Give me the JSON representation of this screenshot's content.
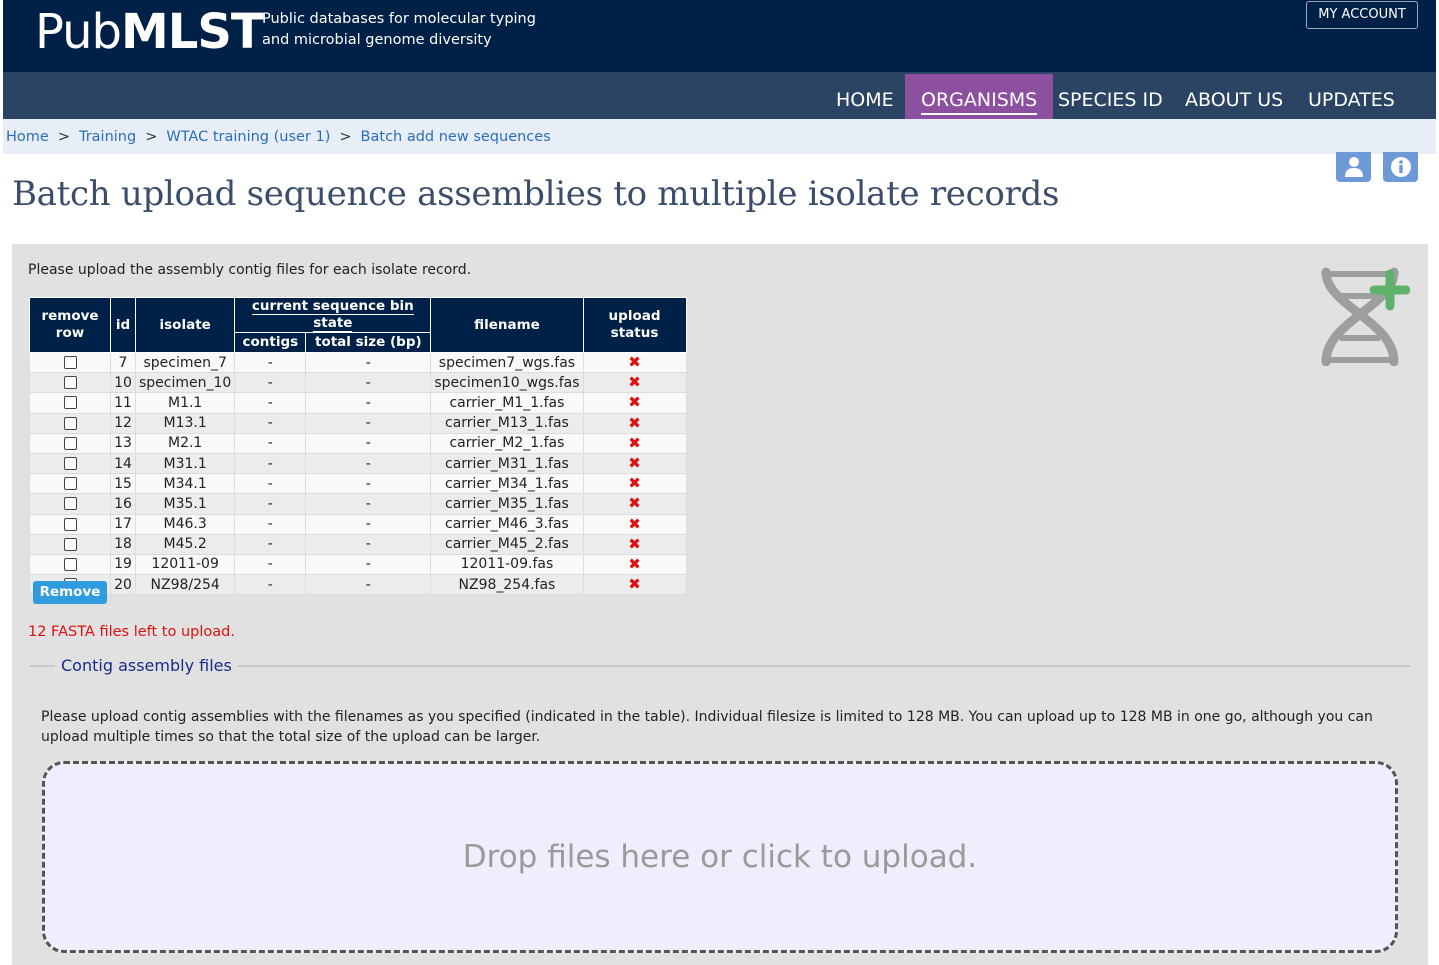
{
  "header": {
    "logo_regular": "Pub",
    "logo_bold": "MLST",
    "tagline": "Public databases for molecular typing\nand microbial genome diversity",
    "my_account": "MY ACCOUNT"
  },
  "nav": {
    "items": [
      {
        "label": "HOME"
      },
      {
        "label": "ORGANISMS"
      },
      {
        "label": "SPECIES ID"
      },
      {
        "label": "ABOUT US"
      },
      {
        "label": "UPDATES"
      }
    ],
    "active": "ORGANISMS"
  },
  "breadcrumb": {
    "items": [
      "Home",
      "Training",
      "WTAC training (user 1)",
      "Batch add new sequences"
    ],
    "separator": ">"
  },
  "page": {
    "title": "Batch upload sequence assemblies to multiple isolate records",
    "intro": "Please upload the assembly contig files for each isolate record."
  },
  "table": {
    "headers": {
      "remove_row": "remove row",
      "id": "id",
      "isolate": "isolate",
      "bin_state": "current sequence bin state",
      "contigs": "contigs",
      "total_size": "total size (bp)",
      "filename": "filename",
      "upload_status": "upload status"
    },
    "rows": [
      {
        "id": "7",
        "isolate": "specimen_7",
        "contigs": "-",
        "total_size": "-",
        "filename": "specimen7_wgs.fas",
        "status": "✖"
      },
      {
        "id": "10",
        "isolate": "specimen_10",
        "contigs": "-",
        "total_size": "-",
        "filename": "specimen10_wgs.fas",
        "status": "✖"
      },
      {
        "id": "11",
        "isolate": "M1.1",
        "contigs": "-",
        "total_size": "-",
        "filename": "carrier_M1_1.fas",
        "status": "✖"
      },
      {
        "id": "12",
        "isolate": "M13.1",
        "contigs": "-",
        "total_size": "-",
        "filename": "carrier_M13_1.fas",
        "status": "✖"
      },
      {
        "id": "13",
        "isolate": "M2.1",
        "contigs": "-",
        "total_size": "-",
        "filename": "carrier_M2_1.fas",
        "status": "✖"
      },
      {
        "id": "14",
        "isolate": "M31.1",
        "contigs": "-",
        "total_size": "-",
        "filename": "carrier_M31_1.fas",
        "status": "✖"
      },
      {
        "id": "15",
        "isolate": "M34.1",
        "contigs": "-",
        "total_size": "-",
        "filename": "carrier_M34_1.fas",
        "status": "✖"
      },
      {
        "id": "16",
        "isolate": "M35.1",
        "contigs": "-",
        "total_size": "-",
        "filename": "carrier_M35_1.fas",
        "status": "✖"
      },
      {
        "id": "17",
        "isolate": "M46.3",
        "contigs": "-",
        "total_size": "-",
        "filename": "carrier_M46_3.fas",
        "status": "✖"
      },
      {
        "id": "18",
        "isolate": "M45.2",
        "contigs": "-",
        "total_size": "-",
        "filename": "carrier_M45_2.fas",
        "status": "✖"
      },
      {
        "id": "19",
        "isolate": "12011-09",
        "contigs": "-",
        "total_size": "-",
        "filename": "12011-09.fas",
        "status": "✖"
      },
      {
        "id": "20",
        "isolate": "NZ98/254",
        "contigs": "-",
        "total_size": "-",
        "filename": "NZ98_254.fas",
        "status": "✖"
      }
    ]
  },
  "remove_button": "Remove",
  "files_left_message": "12 FASTA files left to upload.",
  "contig_section": {
    "legend": "Contig assembly files",
    "description": "Please upload contig assemblies with the filenames as you specified (indicated in the table). Individual filesize is limited to 128 MB. You can upload up to 128 MB in one go, although you can upload multiple times so that the total size of the upload can be larger.",
    "dropzone_text": "Drop files here or click to upload."
  },
  "icons": {
    "account": "user-icon",
    "info": "info-icon",
    "dna_add": "dna-add-icon",
    "status_fail": "red-cross-icon"
  },
  "colors": {
    "header_bg": "#002147",
    "nav_bg": "#2b4464",
    "nav_active": "#8d50a0",
    "link": "#2a6ebb",
    "error": "#e01010",
    "button": "#2f9ce0"
  }
}
